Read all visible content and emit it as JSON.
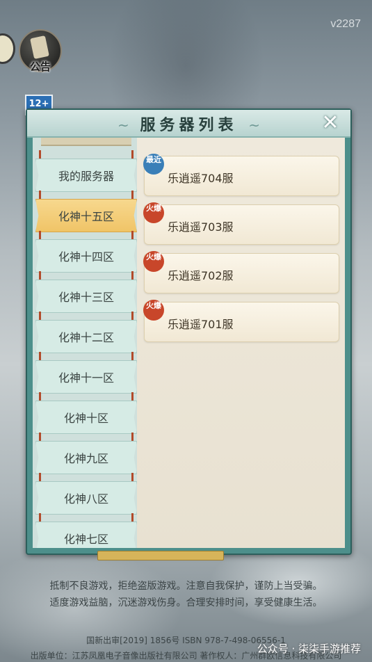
{
  "version": "v2287",
  "notice_button_label": "公告",
  "age_badge": "12+",
  "panel": {
    "title": "服务器列表",
    "close_icon": "close-icon"
  },
  "sidebar": {
    "items": [
      {
        "label": "我的服务器",
        "active": false
      },
      {
        "label": "化神十五区",
        "active": true
      },
      {
        "label": "化神十四区",
        "active": false
      },
      {
        "label": "化神十三区",
        "active": false
      },
      {
        "label": "化神十二区",
        "active": false
      },
      {
        "label": "化神十一区",
        "active": false
      },
      {
        "label": "化神十区",
        "active": false
      },
      {
        "label": "化神九区",
        "active": false
      },
      {
        "label": "化神八区",
        "active": false
      },
      {
        "label": "化神七区",
        "active": false
      }
    ]
  },
  "servers": [
    {
      "name": "乐逍遥704服",
      "badge": "最近",
      "badge_color": "#3a7fb8"
    },
    {
      "name": "乐逍遥703服",
      "badge": "火爆",
      "badge_color": "#c8462a"
    },
    {
      "name": "乐逍遥702服",
      "badge": "火爆",
      "badge_color": "#c8462a"
    },
    {
      "name": "乐逍遥701服",
      "badge": "火爆",
      "badge_color": "#c8462a"
    }
  ],
  "footer": {
    "line1": "抵制不良游戏，拒绝盗版游戏。注意自我保护，谨防上当受骗。",
    "line2": "适度游戏益脑，沉迷游戏伤身。合理安排时间，享受健康生活。",
    "line3": "国新出审[2019] 1856号          ISBN 978-7-498-06556-1",
    "line4": "出版单位：江苏凤凰电子音像出版社有限公司     著作权人：广州群欧信息科技有限公司"
  },
  "watermark": "公众号 · 柒柒手游推荐"
}
